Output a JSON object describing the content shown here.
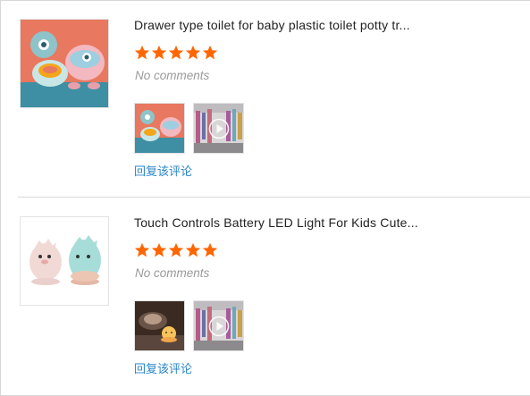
{
  "reviews": [
    {
      "title": "Drawer type toilet for baby plastic toilet potty tr...",
      "rating": 5,
      "comment_status": "No comments",
      "reply_label": "回复该评论",
      "media": [
        {
          "kind": "image",
          "icon": "potty-photo"
        },
        {
          "kind": "video",
          "icon": "play-icon"
        }
      ]
    },
    {
      "title": "Touch Controls Battery LED Light For Kids Cute...",
      "rating": 5,
      "comment_status": "No comments",
      "reply_label": "回复该评论",
      "media": [
        {
          "kind": "image",
          "icon": "night-light-photo"
        },
        {
          "kind": "video",
          "icon": "play-icon"
        }
      ]
    }
  ],
  "colors": {
    "star": "#f60",
    "link": "#2a86c9",
    "muted": "#9a9a9a",
    "title": "#222222"
  }
}
